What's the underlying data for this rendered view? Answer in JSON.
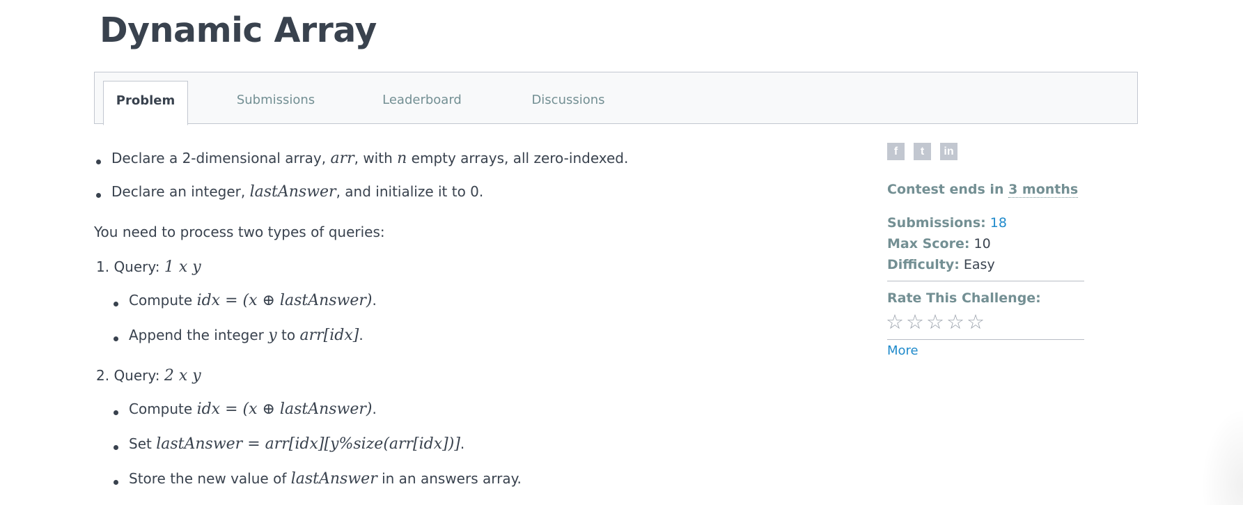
{
  "page": {
    "title": "Dynamic Array"
  },
  "tabs": [
    {
      "label": "Problem",
      "active": true
    },
    {
      "label": "Submissions",
      "active": false
    },
    {
      "label": "Leaderboard",
      "active": false
    },
    {
      "label": "Discussions",
      "active": false
    }
  ],
  "content": {
    "bullet1": {
      "pre": "Declare a 2-dimensional array, ",
      "m1": "arr",
      "mid": ", with ",
      "m2": "n",
      "post": " empty arrays, all zero-indexed."
    },
    "bullet2": {
      "pre": "Declare an integer, ",
      "m1": "lastAnswer",
      "post": ", and initialize it to 0."
    },
    "intro": "You need to process two types of queries:",
    "query1": {
      "label": "1. Query: ",
      "math": "1 x y"
    },
    "q1_compute": {
      "pre": "Compute ",
      "math": "idx = (x ⊕ lastAnswer)",
      "post": "."
    },
    "q1_append": {
      "pre": "Append the integer ",
      "m1": "y",
      "mid": " to ",
      "m2": "arr[idx]",
      "post": "."
    },
    "query2": {
      "label": "2. Query: ",
      "math": "2 x y"
    },
    "q2_compute": {
      "pre": "Compute ",
      "math": "idx = (x ⊕ lastAnswer)",
      "post": "."
    },
    "q2_set": {
      "pre": "Set ",
      "math": "lastAnswer = arr[idx][y%size(arr[idx])]",
      "post": "."
    },
    "q2_store": {
      "pre": "Store the new value of ",
      "math": "lastAnswer",
      "post": " in an answers array."
    }
  },
  "sidebar": {
    "social": [
      {
        "icon": "facebook-icon",
        "glyph": "f"
      },
      {
        "icon": "twitter-icon",
        "glyph": "t"
      },
      {
        "icon": "linkedin-icon",
        "glyph": "in"
      }
    ],
    "contest_prefix": "Contest ends in ",
    "contest_link": "3 months",
    "submissions_label": "Submissions:",
    "submissions_value": "18",
    "max_score_label": "Max Score:",
    "max_score_value": "10",
    "difficulty_label": "Difficulty:",
    "difficulty_value": "Easy",
    "rate_label": "Rate This Challenge:",
    "stars": "☆☆☆☆☆",
    "rating_value": 0,
    "more_link": "More"
  },
  "colors": {
    "accent": "#1f8acb",
    "text": "#39424e",
    "muted": "#738f93"
  }
}
